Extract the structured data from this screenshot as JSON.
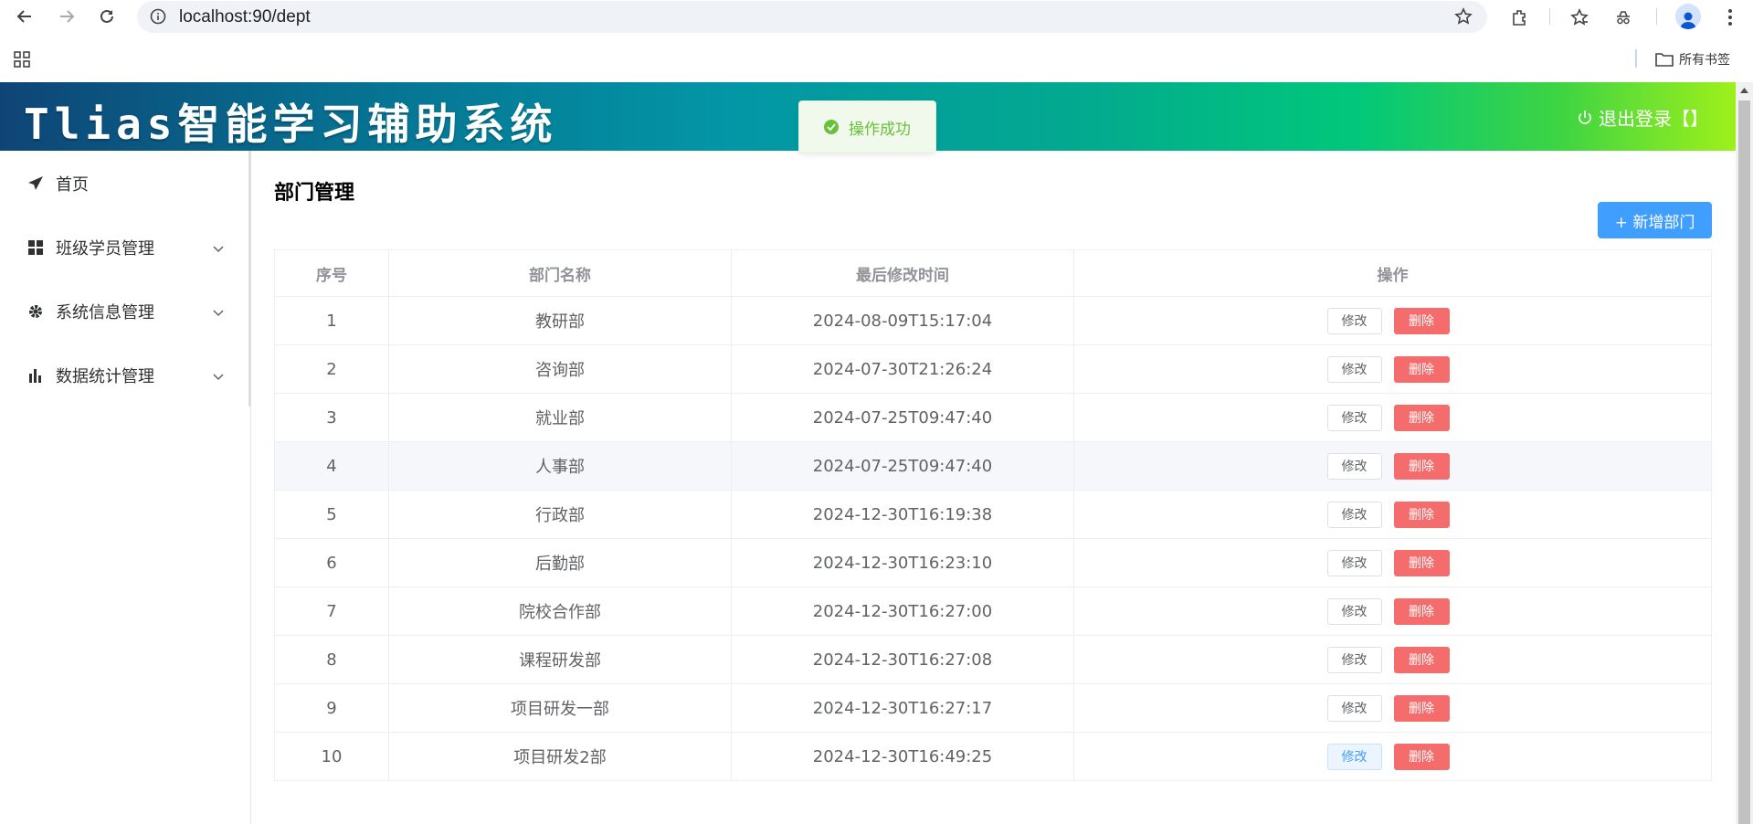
{
  "browser": {
    "url": "localhost:90/dept",
    "bookmarks_label": "所有书签"
  },
  "header": {
    "title": "Tlias智能学习辅助系统",
    "logout_label": "退出登录【】"
  },
  "toast": {
    "message": "操作成功",
    "color": "#67c23a"
  },
  "sidebar": {
    "items": [
      {
        "label": "首页",
        "icon": "paper-plane-icon"
      },
      {
        "label": "班级学员管理",
        "icon": "grid-icon"
      },
      {
        "label": "系统信息管理",
        "icon": "gear-icon"
      },
      {
        "label": "数据统计管理",
        "icon": "bar-chart-icon"
      }
    ]
  },
  "main": {
    "title": "部门管理",
    "add_button": "+ 新增部门",
    "table": {
      "headers": [
        "序号",
        "部门名称",
        "最后修改时间",
        "操作"
      ],
      "edit_label": "修改",
      "delete_label": "删除",
      "rows": [
        {
          "no": "1",
          "name": "教研部",
          "time": "2024-08-09T15:17:04"
        },
        {
          "no": "2",
          "name": "咨询部",
          "time": "2024-07-30T21:26:24"
        },
        {
          "no": "3",
          "name": "就业部",
          "time": "2024-07-25T09:47:40"
        },
        {
          "no": "4",
          "name": "人事部",
          "time": "2024-07-25T09:47:40"
        },
        {
          "no": "5",
          "name": "行政部",
          "time": "2024-12-30T16:19:38"
        },
        {
          "no": "6",
          "name": "后勤部",
          "time": "2024-12-30T16:23:10"
        },
        {
          "no": "7",
          "name": "院校合作部",
          "time": "2024-12-30T16:27:00"
        },
        {
          "no": "8",
          "name": "课程研发部",
          "time": "2024-12-30T16:27:08"
        },
        {
          "no": "9",
          "name": "项目研发一部",
          "time": "2024-12-30T16:27:17"
        },
        {
          "no": "10",
          "name": "项目研发2部",
          "time": "2024-12-30T16:49:25"
        }
      ]
    }
  },
  "colors": {
    "primary": "#409eff",
    "danger": "#f56c6c",
    "success": "#67c23a"
  }
}
